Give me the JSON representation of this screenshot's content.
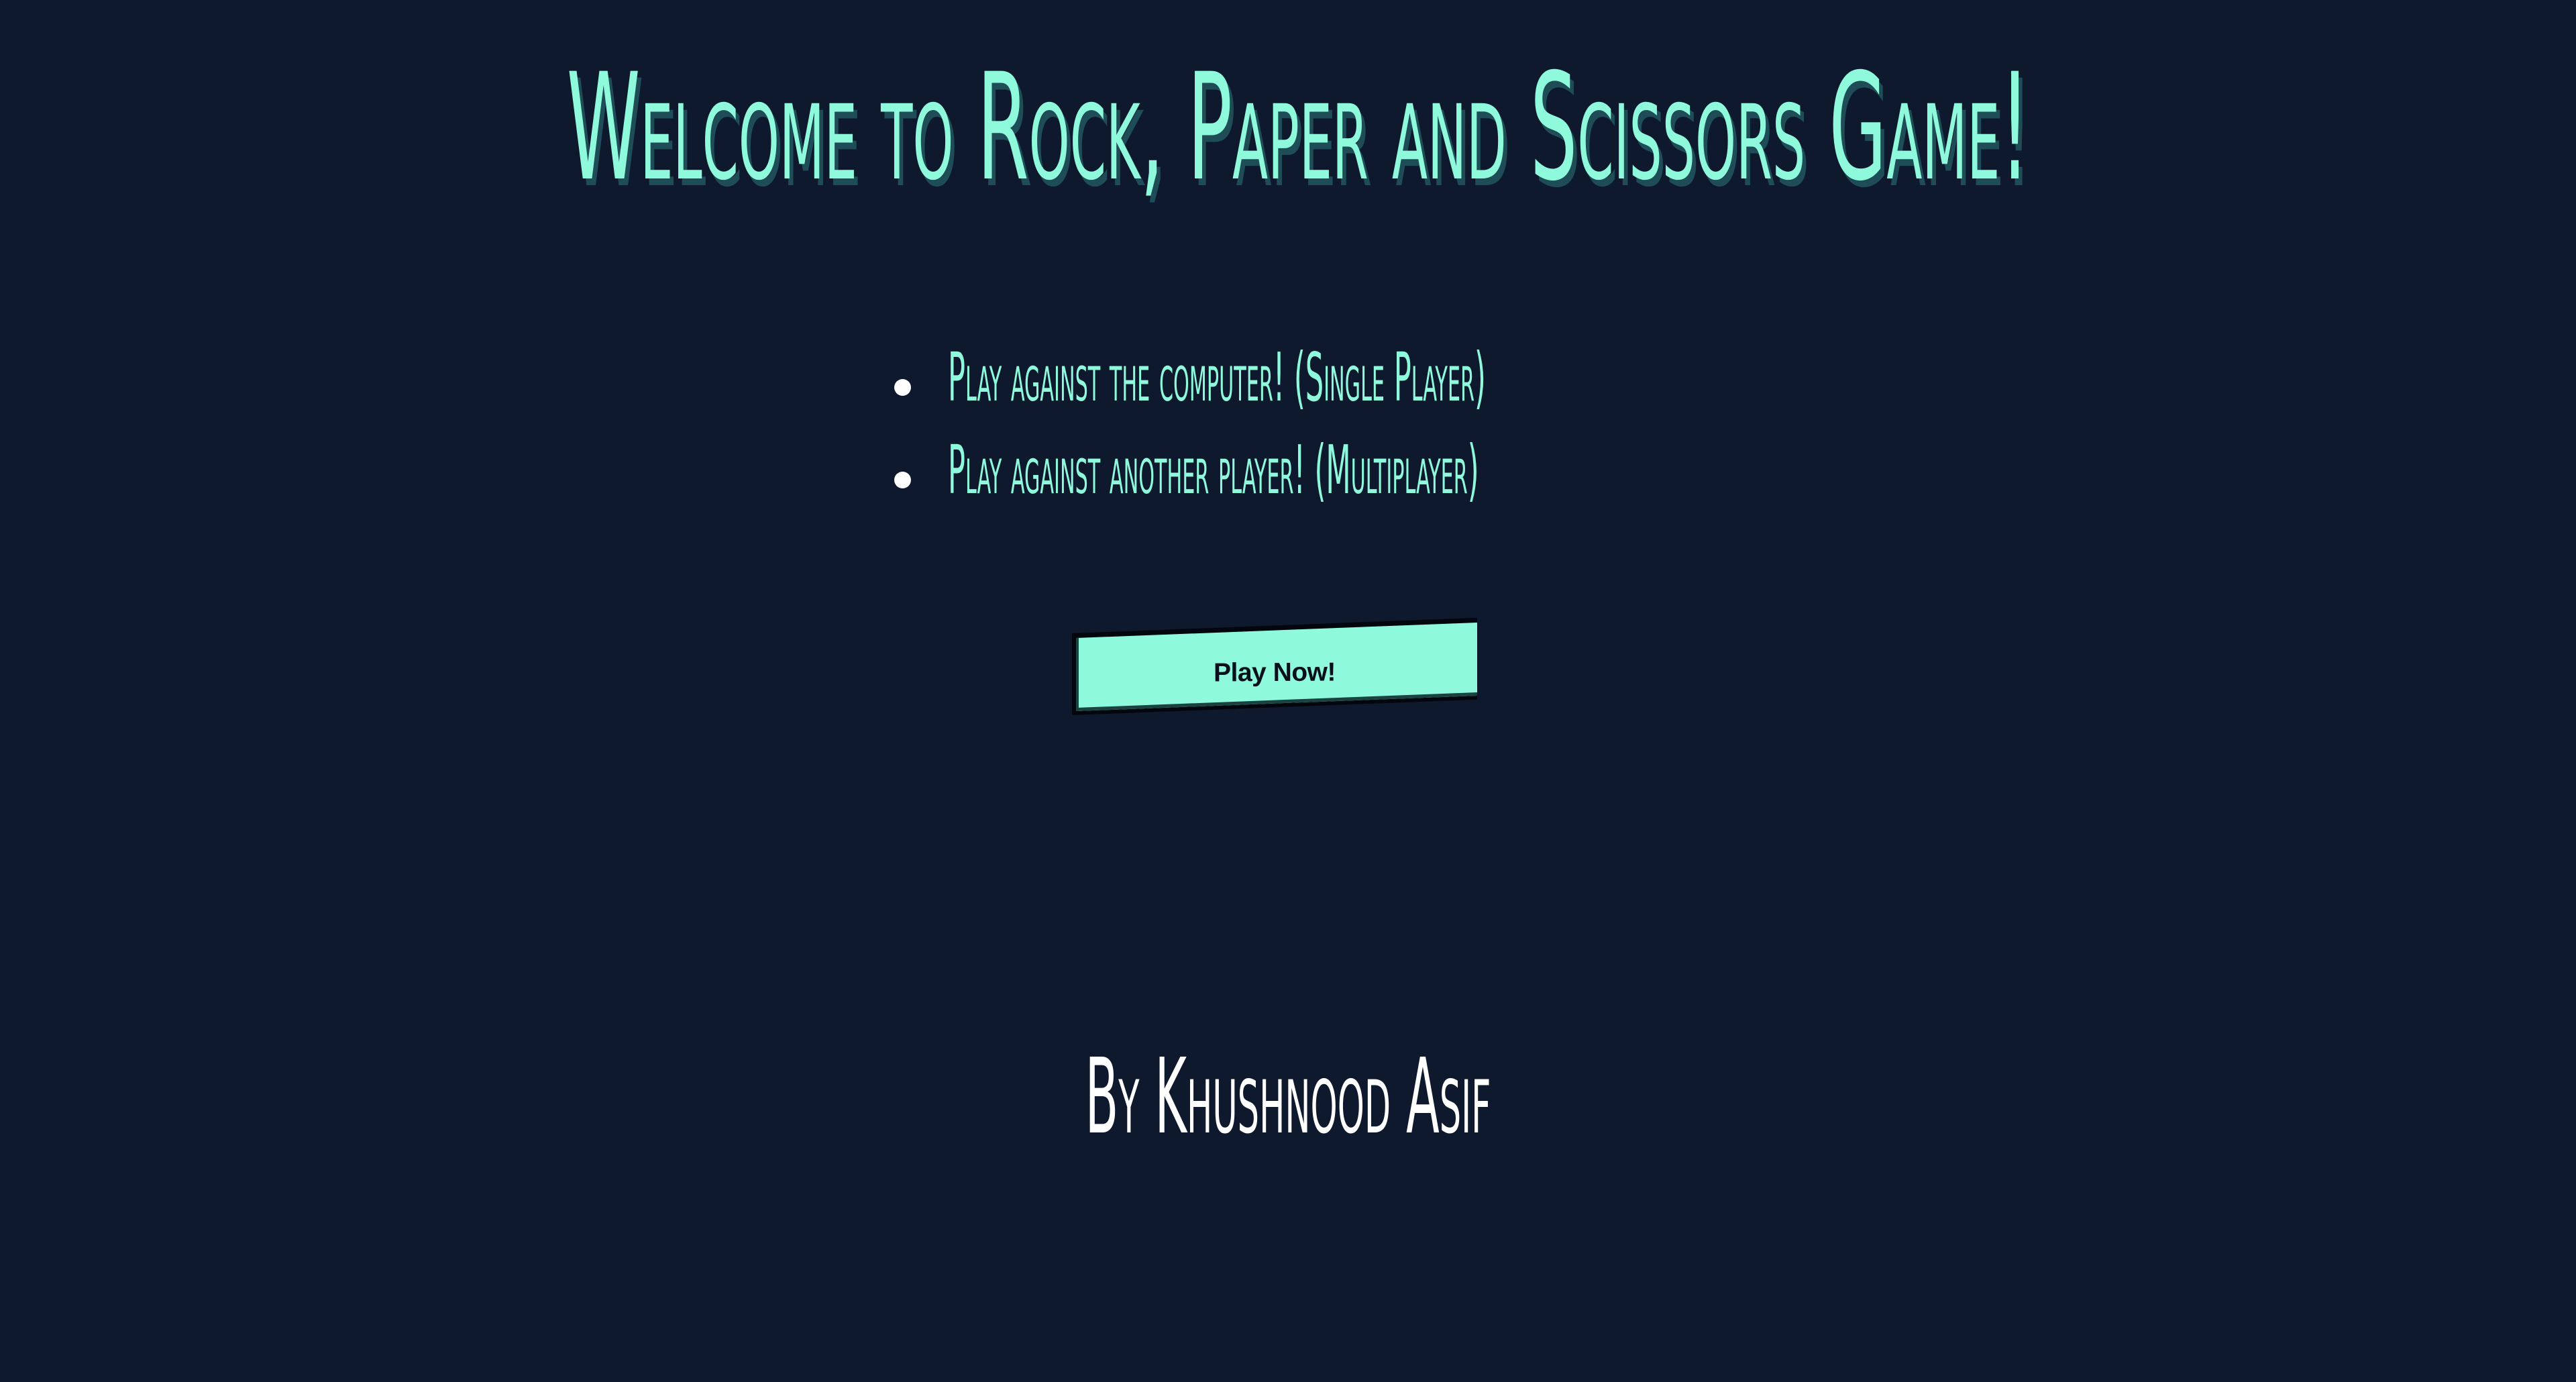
{
  "page": {
    "title": "Welcome to Rock, Paper and Scissors Game!",
    "features": [
      {
        "label": "Play against the computer! (Single Player)"
      },
      {
        "label": "Play against another player! (Multiplayer)"
      }
    ],
    "play_button_label": "Play Now!",
    "author_credit": "By Khushnood Asif"
  },
  "colors": {
    "background": "#0f192e",
    "accent": "#8ff9dc",
    "text_light": "#ffffff",
    "button_text": "#08111b"
  },
  "icons": {
    "feature_bullet": "bullet-dot-icon"
  }
}
